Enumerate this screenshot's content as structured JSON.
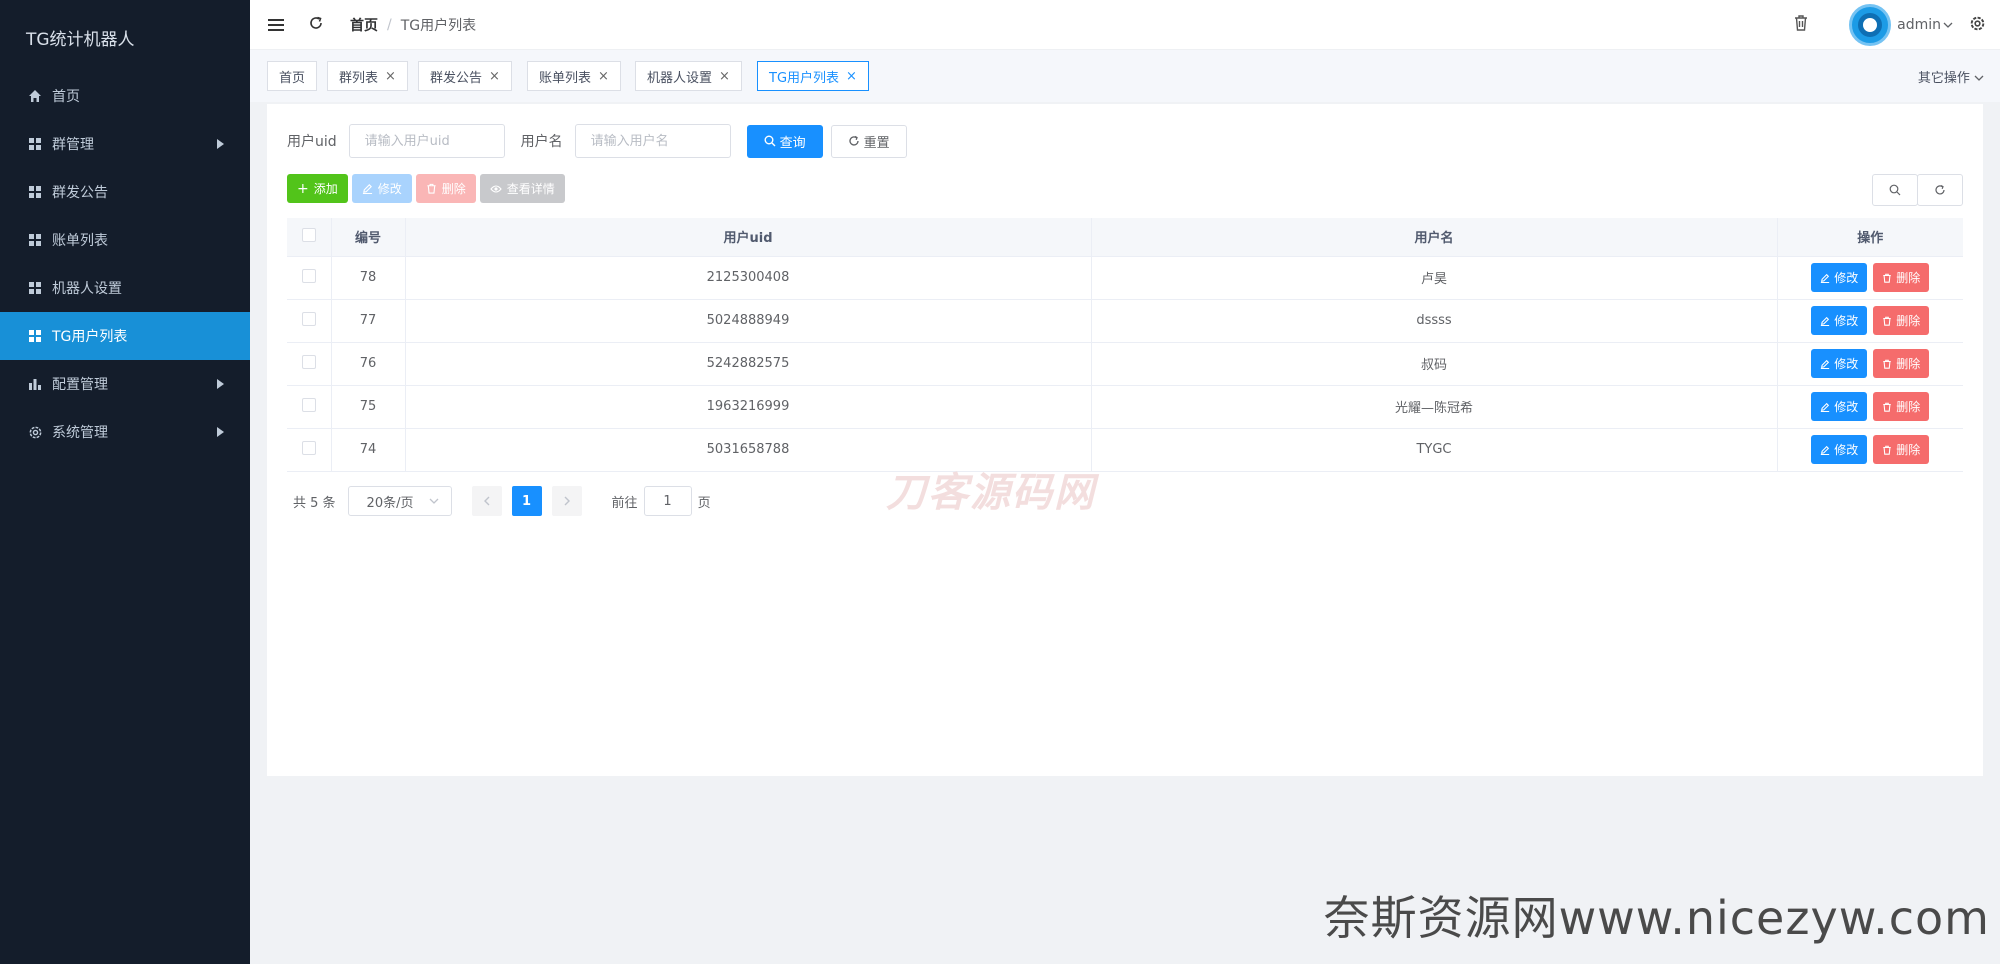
{
  "app": {
    "title": "TG统计机器人"
  },
  "sidebar": {
    "items": [
      {
        "label": "首页",
        "icon": "home-icon",
        "has_arrow": false,
        "active": false
      },
      {
        "label": "群管理",
        "icon": "grid-icon",
        "has_arrow": true,
        "active": false
      },
      {
        "label": "群发公告",
        "icon": "grid-icon",
        "has_arrow": false,
        "active": false
      },
      {
        "label": "账单列表",
        "icon": "grid-icon",
        "has_arrow": false,
        "active": false
      },
      {
        "label": "机器人设置",
        "icon": "grid-icon",
        "has_arrow": false,
        "active": false
      },
      {
        "label": "TG用户列表",
        "icon": "grid-icon",
        "has_arrow": false,
        "active": true
      },
      {
        "label": "配置管理",
        "icon": "bar-chart-icon",
        "has_arrow": true,
        "active": false
      },
      {
        "label": "系统管理",
        "icon": "gear-icon",
        "has_arrow": true,
        "active": false
      }
    ]
  },
  "header": {
    "breadcrumb_home": "首页",
    "breadcrumb_sep": "/",
    "breadcrumb_current": "TG用户列表",
    "username": "admin"
  },
  "tabs": {
    "items": [
      {
        "label": "首页",
        "closable": false,
        "active": false
      },
      {
        "label": "群列表",
        "closable": true,
        "active": false
      },
      {
        "label": "群发公告",
        "closable": true,
        "active": false
      },
      {
        "label": "账单列表",
        "closable": true,
        "active": false
      },
      {
        "label": "机器人设置",
        "closable": true,
        "active": false
      },
      {
        "label": "TG用户列表",
        "closable": true,
        "active": true
      }
    ],
    "close_glyph": "×",
    "other_ops": "其它操作"
  },
  "search": {
    "uid_label": "用户uid",
    "uid_placeholder": "请输入用户uid",
    "name_label": "用户名",
    "name_placeholder": "请输入用户名",
    "query_label": "查询",
    "reset_label": "重置"
  },
  "toolbar": {
    "add_label": "添加",
    "edit_label": "修改",
    "delete_label": "删除",
    "view_label": "查看详情"
  },
  "table": {
    "columns": [
      "编号",
      "用户uid",
      "用户名",
      "操作"
    ],
    "rows": [
      {
        "id": "78",
        "uid": "2125300408",
        "name": "卢昊"
      },
      {
        "id": "77",
        "uid": "5024888949",
        "name": "dssss"
      },
      {
        "id": "76",
        "uid": "5242882575",
        "name": "叔码"
      },
      {
        "id": "75",
        "uid": "1963216999",
        "name": "光耀—陈冠希"
      },
      {
        "id": "74",
        "uid": "5031658788",
        "name": "TYGC"
      }
    ],
    "row_edit_label": "修改",
    "row_delete_label": "删除"
  },
  "pagination": {
    "total_text": "共 5 条",
    "page_size": "20条/页",
    "current_page": "1",
    "goto_label": "前往",
    "goto_value": "1",
    "page_suffix": "页"
  },
  "watermarks": {
    "center": "刀客源码网",
    "corner": "奈斯资源网www.nicezyw.com"
  },
  "colors": {
    "sidebar_bg": "#141d2b",
    "active_menu": "#1890d7",
    "primary": "#1890ff",
    "success": "#52c41a",
    "danger": "#f56c6c"
  }
}
